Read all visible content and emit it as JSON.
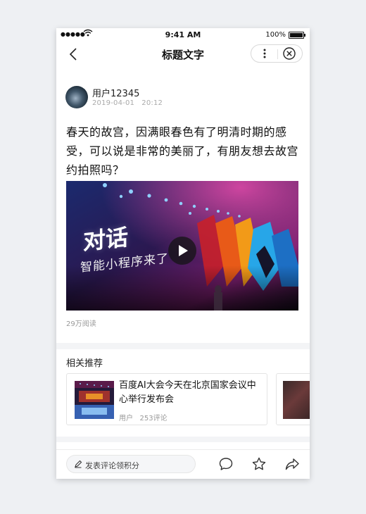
{
  "status_bar": {
    "time": "9:41 AM",
    "battery": "100%",
    "signal_dots": "●●●●●"
  },
  "nav": {
    "title": "标题文字"
  },
  "author": {
    "name": "用户12345",
    "date": "2019-04-01",
    "time": "20:12"
  },
  "post": {
    "text": "春天的故宫，因满眼春色有了明清时期的感受，可以说是非常的美丽了，有朋友想去故宫约拍照吗？"
  },
  "video": {
    "caption_line1": "对话",
    "caption_line2": "智能小程序来了"
  },
  "stats": {
    "reads": "29万阅读"
  },
  "recommend": {
    "heading": "相关推荐",
    "cards": [
      {
        "title": "百度AI大会今天在北京国家会议中心举行发布会",
        "author": "用户",
        "comments": "253评论"
      }
    ]
  },
  "bottom_bar": {
    "comment_placeholder": "发表评论领积分"
  },
  "icons": [
    "back-icon",
    "more-icon",
    "close-icon",
    "play-icon",
    "pen-icon",
    "comment-icon",
    "star-icon",
    "share-icon"
  ]
}
